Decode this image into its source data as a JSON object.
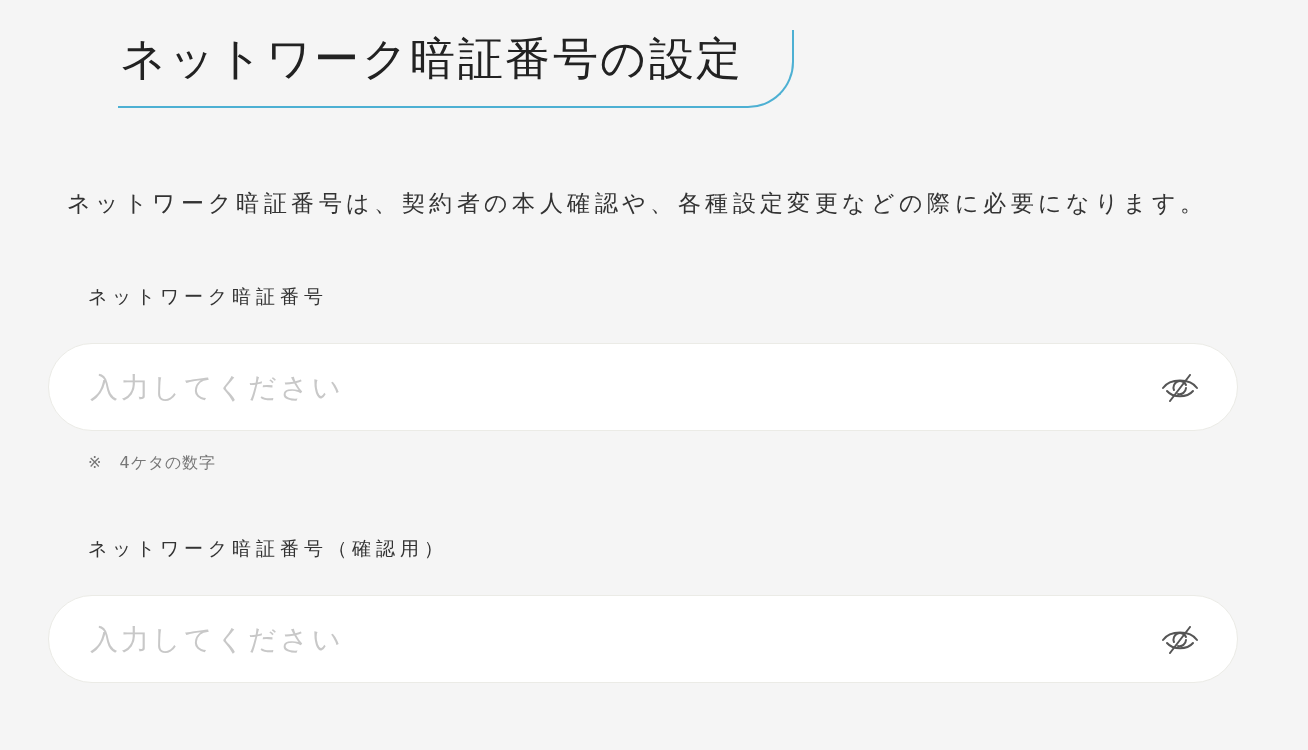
{
  "title": "ネットワーク暗証番号の設定",
  "description": "ネットワーク暗証番号は、契約者の本人確認や、各種設定変更などの際に必要になります。",
  "fields": [
    {
      "label": "ネットワーク暗証番号",
      "placeholder": "入力してください",
      "note": "※　4ケタの数字"
    },
    {
      "label": "ネットワーク暗証番号（確認用）",
      "placeholder": "入力してください"
    }
  ]
}
